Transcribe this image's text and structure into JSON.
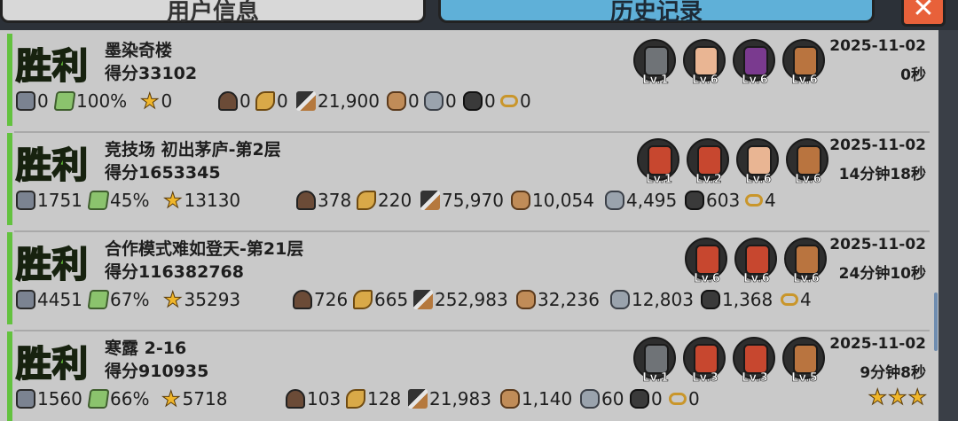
{
  "tabs": {
    "user_info": "用户信息",
    "history": "历史记录",
    "close": "✕"
  },
  "records": [
    {
      "result": "胜利",
      "stage": "墨染奇楼",
      "score": "得分33102",
      "date": "2025-11-02",
      "duration": "0秒",
      "stats": {
        "bag": "0",
        "map": "100%",
        "star": "0",
        "people": "0",
        "wheat": "0",
        "brush": "21,900",
        "wood": "0",
        "stone": "0",
        "coal": "0",
        "chain": "0"
      },
      "heroes": [
        {
          "level": "Lv.1",
          "look": "gray"
        },
        {
          "level": "Lv.6",
          "look": "redface"
        },
        {
          "level": "Lv.6",
          "look": "purple"
        },
        {
          "level": "Lv.6",
          "look": "brown"
        }
      ],
      "stars": ""
    },
    {
      "result": "胜利",
      "stage": "竞技场 初出茅庐-第2层",
      "score": "得分1653345",
      "date": "2025-11-02",
      "duration": "14分钟18秒",
      "stats": {
        "bag": "1751",
        "map": "45%",
        "star": "13130",
        "people": "378",
        "wheat": "220",
        "brush": "75,970",
        "wood": "10,054",
        "stone": "4,495",
        "coal": "603",
        "chain": "4"
      },
      "heroes": [
        {
          "level": "Lv.1",
          "look": "red"
        },
        {
          "level": "Lv.2",
          "look": "red"
        },
        {
          "level": "Lv.6",
          "look": "redface"
        },
        {
          "level": "Lv.6",
          "look": "brown"
        }
      ],
      "stars": ""
    },
    {
      "result": "胜利",
      "stage": "合作模式难如登天-第21层",
      "score": "得分116382768",
      "date": "2025-11-02",
      "duration": "24分钟10秒",
      "stats": {
        "bag": "4451",
        "map": "67%",
        "star": "35293",
        "people": "726",
        "wheat": "665",
        "brush": "252,983",
        "wood": "32,236",
        "stone": "12,803",
        "coal": "1,368",
        "chain": "4"
      },
      "heroes": [
        {
          "level": "Lv.6",
          "look": "red"
        },
        {
          "level": "Lv.6",
          "look": "red"
        },
        {
          "level": "Lv.6",
          "look": "brown"
        }
      ],
      "stars": ""
    },
    {
      "result": "胜利",
      "stage": "寒露 2-16",
      "score": "得分910935",
      "date": "2025-11-02",
      "duration": "9分钟8秒",
      "stats": {
        "bag": "1560",
        "map": "66%",
        "star": "5718",
        "people": "103",
        "wheat": "128",
        "brush": "21,983",
        "wood": "1,140",
        "stone": "60",
        "coal": "0",
        "chain": "0"
      },
      "heroes": [
        {
          "level": "Lv.1",
          "look": "gray"
        },
        {
          "level": "Lv.3",
          "look": "red"
        },
        {
          "level": "Lv.3",
          "look": "red"
        },
        {
          "level": "Lv.5",
          "look": "brown"
        }
      ],
      "stars": "★★★"
    }
  ]
}
